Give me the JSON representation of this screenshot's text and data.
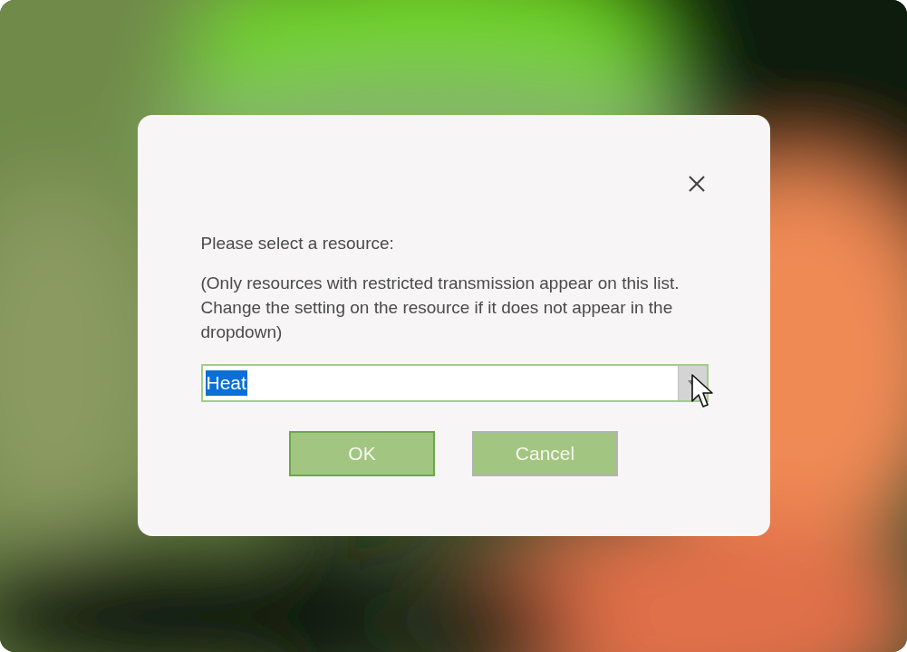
{
  "dialog": {
    "prompt": "Please select a resource:",
    "note": "(Only resources with restricted transmission appear on this list. Change the setting on the resource if it does not appear in the dropdown)",
    "resource": {
      "value": "Heat",
      "selected": true
    },
    "buttons": [
      {
        "label": "OK",
        "default": true
      },
      {
        "label": "Cancel",
        "default": false
      }
    ]
  }
}
